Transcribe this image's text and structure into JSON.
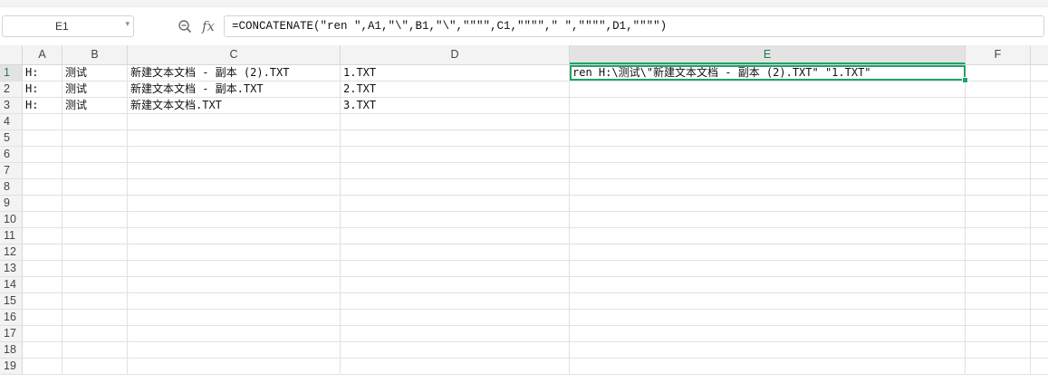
{
  "name_box": {
    "value": "E1"
  },
  "formula_bar": {
    "fx_label": "fx",
    "formula": "=CONCATENATE(\"ren \",A1,\"\\\",B1,\"\\\",\"\"\"\",C1,\"\"\"\",\" \",\"\"\"\",D1,\"\"\"\")"
  },
  "sheet": {
    "active_cell": "E1",
    "columns": [
      {
        "label": "A"
      },
      {
        "label": "B"
      },
      {
        "label": "C"
      },
      {
        "label": "D"
      },
      {
        "label": "E"
      },
      {
        "label": "F"
      }
    ],
    "row_numbers": [
      "1",
      "2",
      "3",
      "4",
      "5",
      "6",
      "7",
      "8",
      "9",
      "10",
      "11",
      "12",
      "13",
      "14",
      "15",
      "16",
      "17",
      "18",
      "19"
    ],
    "rows": [
      {
        "A": "H:",
        "B": "测试",
        "C": "新建文本文档 - 副本 (2).TXT",
        "D": "1.TXT",
        "E": "ren H:\\测试\\\"新建文本文档 - 副本 (2).TXT\" \"1.TXT\"",
        "F": ""
      },
      {
        "A": "H:",
        "B": "测试",
        "C": "新建文本文档 - 副本.TXT",
        "D": "2.TXT",
        "E": "",
        "F": ""
      },
      {
        "A": "H:",
        "B": "测试",
        "C": "新建文本文档.TXT",
        "D": "3.TXT",
        "E": "",
        "F": ""
      }
    ]
  }
}
